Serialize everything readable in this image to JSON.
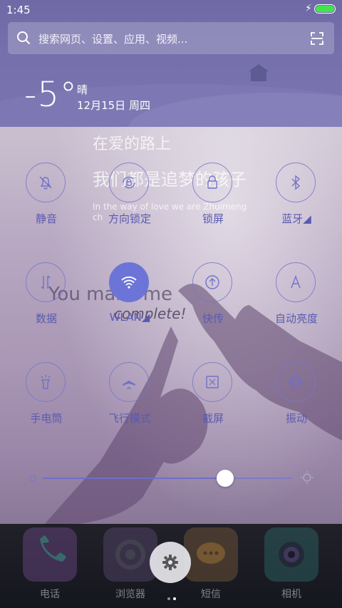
{
  "status": {
    "time": "1:45",
    "battery_level": 1.0,
    "charging_icon": "bolt-icon"
  },
  "search": {
    "placeholder": "搜索网页、设置、应用、视频..."
  },
  "weather": {
    "temperature": "-5°",
    "condition": "晴",
    "date": "12月15日 周四"
  },
  "wallpaper_text": {
    "line1": "在爱的路上",
    "line2": "我们都是追梦的孩子",
    "line3": "In the way of love we are Zhuimeng",
    "line4": "ch",
    "line5": "You make me",
    "line6": "complete!"
  },
  "toggles": [
    {
      "id": "mute",
      "label": "静音",
      "icon": "bell-off-icon",
      "active": false
    },
    {
      "id": "rotation-lock",
      "label": "方向锁定",
      "icon": "rotation-lock-icon",
      "active": false
    },
    {
      "id": "lock-screen",
      "label": "锁屏",
      "icon": "lock-icon",
      "active": false
    },
    {
      "id": "bluetooth",
      "label": "蓝牙◢",
      "icon": "bluetooth-icon",
      "active": false
    },
    {
      "id": "data",
      "label": "数据",
      "icon": "data-arrows-icon",
      "active": false
    },
    {
      "id": "wlan",
      "label": "WLAN◢",
      "icon": "wifi-icon",
      "active": true
    },
    {
      "id": "quick-transfer",
      "label": "快传",
      "icon": "upload-circle-icon",
      "active": false
    },
    {
      "id": "auto-brightness",
      "label": "自动亮度",
      "icon": "auto-brightness-icon",
      "active": false
    },
    {
      "id": "flashlight",
      "label": "手电筒",
      "icon": "flashlight-icon",
      "active": false
    },
    {
      "id": "airplane",
      "label": "飞行模式",
      "icon": "airplane-icon",
      "active": false
    },
    {
      "id": "screenshot",
      "label": "截屏",
      "icon": "screenshot-icon",
      "active": false
    },
    {
      "id": "vibrate",
      "label": "振动",
      "icon": "vibrate-icon",
      "active": false
    }
  ],
  "brightness": {
    "level": 0.73
  },
  "dock": {
    "apps": [
      {
        "label": "电话",
        "icon": "phone-icon",
        "color": "#6f4a8a"
      },
      {
        "label": "浏览器",
        "icon": "browser-icon",
        "color": "#5a4a70"
      },
      {
        "label": "短信",
        "icon": "message-icon",
        "color": "#7a5a3a"
      },
      {
        "label": "相机",
        "icon": "camera-icon",
        "color": "#2f6a6a"
      }
    ],
    "page_count": 2,
    "current_page": 1
  }
}
